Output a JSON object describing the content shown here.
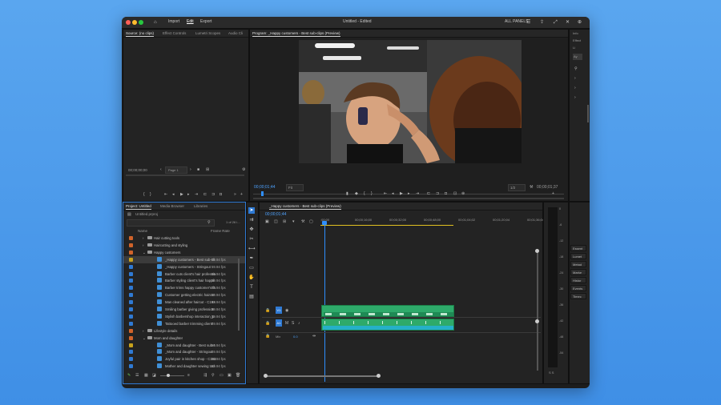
{
  "window": {
    "title": "Untitled - Edited"
  },
  "nav": {
    "home_icon": "home-icon",
    "import": "Import",
    "edit": "Edit",
    "export": "Export"
  },
  "topright": {
    "workspace": "ALL PANELS"
  },
  "source_panel": {
    "tabs": [
      "Source: (no clips)",
      "Effect Controls",
      "Lumetri Scopes",
      "Audio Cli"
    ],
    "timecode": "00;00;00;00",
    "page_label": "Page 1"
  },
  "program_panel": {
    "tab": "Program: _Happy customers - Best sub-clips (Preview)",
    "timecode": "00;00;01;44",
    "fit": "Fit",
    "resolution": "1/2",
    "duration": "00;00;01;37"
  },
  "right_panel": {
    "items": [
      "Info",
      "Effect",
      "Li",
      "Ay"
    ]
  },
  "right_lower": {
    "items": [
      "Essent",
      "Lumet",
      "Metad",
      "Marke",
      "Histor",
      "Events",
      "Timec"
    ]
  },
  "project": {
    "tabs": [
      "Project: Untitled",
      "Media Browser",
      "Libraries"
    ],
    "file": "Untitled.prproj",
    "count": "1 of 26 i...",
    "col_name": "Name",
    "col_rate": "Frame Rate",
    "rows": [
      {
        "name": "Hair cutting tools",
        "rate": "",
        "type": "folder",
        "color": "#d0632a",
        "indent": 0
      },
      {
        "name": "Haircutting and styling",
        "rate": "",
        "type": "folder",
        "color": "#d0632a",
        "indent": 0
      },
      {
        "name": "Happy customers",
        "rate": "",
        "type": "folder-open",
        "color": "#d0632a",
        "indent": 0
      },
      {
        "name": "_Happy customers - Best sub-cli",
        "rate": "59.94 fps",
        "type": "clip",
        "color": "#c8a21c",
        "indent": 1
      },
      {
        "name": "_Happy customers - Stringout",
        "rate": "59.94 fps",
        "type": "clip",
        "color": "#2f7ad4",
        "indent": 1
      },
      {
        "name": "Barber cuts client's hair professio",
        "rate": "59.94 fps",
        "type": "clip",
        "color": "#2f7ad4",
        "indent": 1
      },
      {
        "name": "Barber styling client's hair happil",
        "rate": "59.94 fps",
        "type": "clip",
        "color": "#2f7ad4",
        "indent": 1
      },
      {
        "name": "Barber trims happy customer's fa",
        "rate": "59.94 fps",
        "type": "clip",
        "color": "#2f7ad4",
        "indent": 1
      },
      {
        "name": "Customer getting electric haircut",
        "rate": "59.94 fps",
        "type": "clip",
        "color": "#2f7ad4",
        "indent": 1
      },
      {
        "name": "Man cleaned after haircut - C193",
        "rate": "59.94 fps",
        "type": "clip",
        "color": "#2f7ad4",
        "indent": 1
      },
      {
        "name": "Smiling barber giving profession",
        "rate": "59.94 fps",
        "type": "clip",
        "color": "#2f7ad4",
        "indent": 1
      },
      {
        "name": "Stylish barbershop interaction_p",
        "rate": "59.94 fps",
        "type": "clip",
        "color": "#2f7ad4",
        "indent": 1
      },
      {
        "name": "Tattooed barber trimming client'",
        "rate": "59.94 fps",
        "type": "clip",
        "color": "#2f7ad4",
        "indent": 1
      },
      {
        "name": "Lifestyle details",
        "rate": "",
        "type": "folder",
        "color": "#d0632a",
        "indent": 0
      },
      {
        "name": "Mom and daughter",
        "rate": "",
        "type": "folder-open",
        "color": "#d0632a",
        "indent": 0
      },
      {
        "name": "_Mom and daughter - Best sub-s",
        "rate": "59.94 fps",
        "type": "clip",
        "color": "#c8a21c",
        "indent": 1
      },
      {
        "name": "_Mom and daughter - Stringout",
        "rate": "59.94 fps",
        "type": "clip",
        "color": "#2f7ad4",
        "indent": 1
      },
      {
        "name": "Joyful pair in kitchen shop - C193",
        "rate": "59.94 fps",
        "type": "clip",
        "color": "#2f7ad4",
        "indent": 1
      },
      {
        "name": "Mother and daughter sewing tod",
        "rate": "59.94 fps",
        "type": "clip",
        "color": "#2f7ad4",
        "indent": 1
      }
    ]
  },
  "timeline": {
    "tab": "_Happy customers - Best sub-clips (Preview)",
    "timecode": "00;00;01;44",
    "ruler": [
      ";00;00",
      "00;00;16;00",
      "00;00;32;00",
      "00;00;48;00",
      "00;01;04;02",
      "00;01;20;04",
      "00;01;36;04"
    ],
    "tracks": {
      "v1": "V1",
      "a1": "A1",
      "mix": "Mix",
      "mix_val": "0.0"
    }
  },
  "meter": {
    "scale": [
      "0",
      "-6",
      "-12",
      "-18",
      "-24",
      "-30",
      "-36",
      "-42",
      "-48",
      "-54"
    ],
    "bottom": "S S"
  },
  "colors": {
    "accent": "#2f7ad4",
    "clip_green": "#2eaa6a",
    "playhead": "#2f8fff"
  }
}
